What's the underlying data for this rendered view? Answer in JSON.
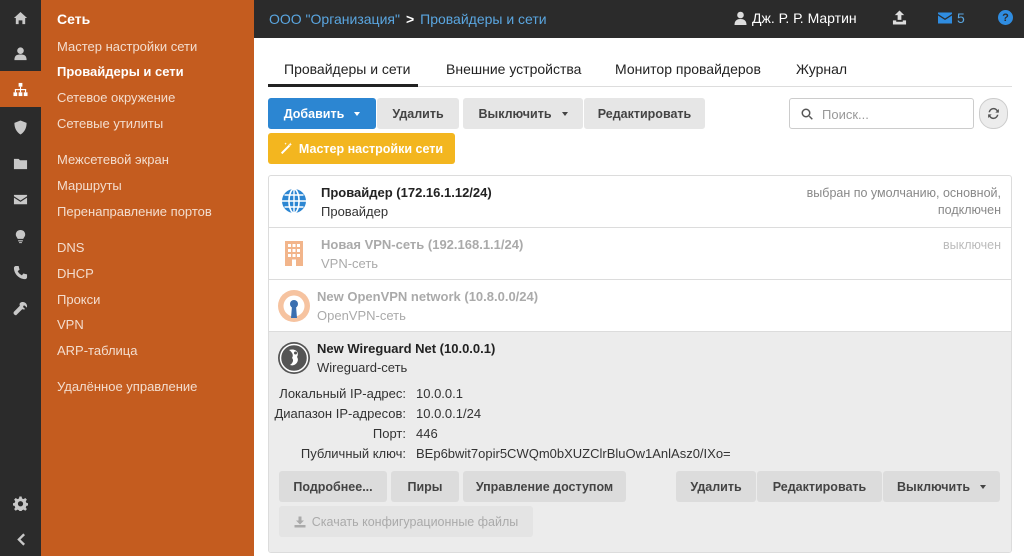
{
  "rail": {
    "icons": [
      "home-icon",
      "user-icon",
      "sitemap-icon",
      "shield-icon",
      "folder-icon",
      "envelope-icon",
      "lightbulb-icon",
      "phone-icon",
      "wrench-icon",
      "gear-icon",
      "chevron-left-icon"
    ]
  },
  "nav": {
    "title": "Сеть",
    "items": [
      {
        "label": "Мастер настройки сети"
      },
      {
        "label": "Провайдеры и сети"
      },
      {
        "label": "Сетевое окружение"
      },
      {
        "label": "Сетевые утилиты"
      },
      {
        "label": "Межсетевой экран"
      },
      {
        "label": "Маршруты"
      },
      {
        "label": "Перенаправление портов"
      },
      {
        "label": "DNS"
      },
      {
        "label": "DHCP"
      },
      {
        "label": "Прокси"
      },
      {
        "label": "VPN"
      },
      {
        "label": "ARP-таблица"
      },
      {
        "label": "Удалённое управление"
      }
    ]
  },
  "header": {
    "org": "ООО \"Организация\"",
    "separator": ">",
    "page": "Провайдеры и сети",
    "user": "Дж. Р. Р. Мартин",
    "mail_count": "5",
    "help": "?"
  },
  "tabs": [
    {
      "label": "Провайдеры и сети"
    },
    {
      "label": "Внешние устройства"
    },
    {
      "label": "Монитор провайдеров"
    },
    {
      "label": "Журнал"
    }
  ],
  "toolbar": {
    "add": "Добавить",
    "delete": "Удалить",
    "disable": "Выключить",
    "edit": "Редактировать",
    "wizard": "Мастер настройки сети",
    "search_placeholder": "Поиск..."
  },
  "networks": [
    {
      "title": "Провайдер (172.16.1.12/24)",
      "subtitle": "Провайдер",
      "status_line1": "выбран по умолчанию, основной,",
      "status_line2": "подключен",
      "icon": "globe-icon"
    },
    {
      "title": "Новая VPN-сеть (192.168.1.1/24)",
      "subtitle": "VPN-сеть",
      "status_line1": "выключен",
      "icon": "building-icon"
    },
    {
      "title": "New OpenVPN network (10.8.0.0/24)",
      "subtitle": "OpenVPN-сеть",
      "icon": "openvpn-icon"
    },
    {
      "title": "New Wireguard Net (10.0.0.1)",
      "subtitle": "Wireguard-сеть",
      "icon": "wireguard-icon"
    }
  ],
  "details": {
    "local_ip_label": "Локальный IP-адрес:",
    "local_ip": "10.0.0.1",
    "range_label": "Диапазон IP-адресов:",
    "range": "10.0.0.1/24",
    "port_label": "Порт:",
    "port": "446",
    "pubkey_label": "Публичный ключ:",
    "pubkey": "BEp6bwit7opir5CWQm0bXUZClrBluOw1AnlAsz0/IXo=",
    "buttons": {
      "more": "Подробнее...",
      "peers": "Пиры",
      "access": "Управление доступом",
      "delete": "Удалить",
      "edit": "Редактировать",
      "disable": "Выключить",
      "download": "Скачать конфигурационные файлы"
    }
  },
  "colors": {
    "accent_orange": "#c45c1f",
    "primary_blue": "#2c86d2",
    "warning_yellow": "#f3b61f",
    "dark_bar": "#2b2b2b"
  }
}
